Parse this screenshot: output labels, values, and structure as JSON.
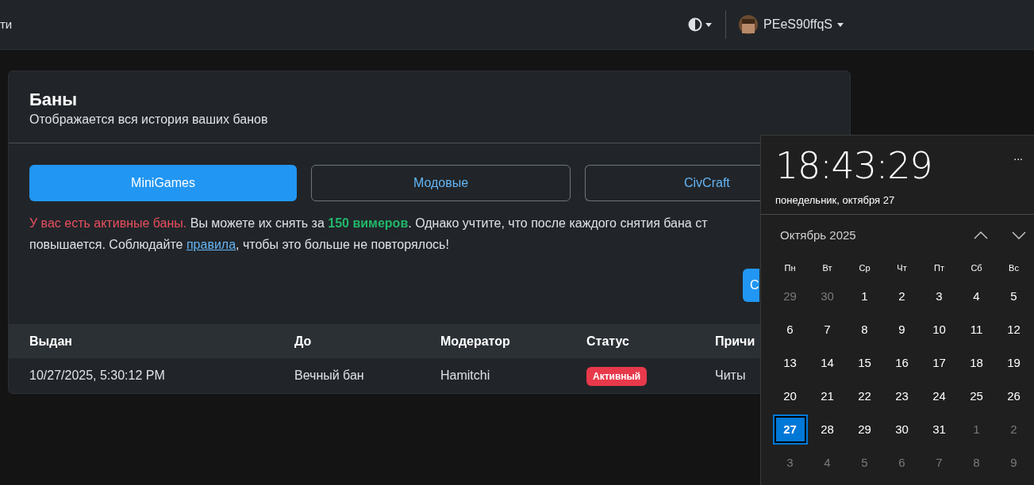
{
  "navbar": {
    "left_text": "ти",
    "username": "PEeS90ffqS"
  },
  "card": {
    "title": "Баны",
    "subtitle": "Отображается вся история ваших банов",
    "tabs": [
      {
        "label": "MiniGames",
        "selected": true
      },
      {
        "label": "Модовые",
        "selected": false
      },
      {
        "label": "CivCraft",
        "selected": false
      }
    ],
    "alert": {
      "warning": "У вас есть активные баны.",
      "line_1": " Вы можете их снять за **150 вимеров**. Однако учтите, что после каждого снятия бана ст",
      "line_2": "повышается. Соблюдайте ",
      "link": "правила",
      "line_2_end": ", чтобы это больше не повторялось!"
    },
    "action_button": "С",
    "table": {
      "columns": [
        "Выдан",
        "До",
        "Модератор",
        "Статус",
        "Причи"
      ],
      "rows": [
        {
          "issued": "10/27/2025, 5:30:12 PM",
          "until": "Вечный бан",
          "moderator": "Hamitchi",
          "status": "Активный",
          "reason": "Читы"
        }
      ]
    }
  },
  "clock_flyout": {
    "time": "18:43:29",
    "date": "понедельник, октября 27",
    "more": "...",
    "month": "Октябрь 2025",
    "weekdays": [
      "Пн",
      "Вт",
      "Ср",
      "Чт",
      "Пт",
      "Сб",
      "Вс"
    ],
    "days": [
      {
        "label": "29",
        "muted": true,
        "selected": false
      },
      {
        "label": "30",
        "muted": true,
        "selected": false
      },
      {
        "label": "1",
        "muted": false,
        "selected": false
      },
      {
        "label": "2",
        "muted": false,
        "selected": false
      },
      {
        "label": "3",
        "muted": false,
        "selected": false
      },
      {
        "label": "4",
        "muted": false,
        "selected": false
      },
      {
        "label": "5",
        "muted": false,
        "selected": false
      },
      {
        "label": "6",
        "muted": false,
        "selected": false
      },
      {
        "label": "7",
        "muted": false,
        "selected": false
      },
      {
        "label": "8",
        "muted": false,
        "selected": false
      },
      {
        "label": "9",
        "muted": false,
        "selected": false
      },
      {
        "label": "10",
        "muted": false,
        "selected": false
      },
      {
        "label": "11",
        "muted": false,
        "selected": false
      },
      {
        "label": "12",
        "muted": false,
        "selected": false
      },
      {
        "label": "13",
        "muted": false,
        "selected": false
      },
      {
        "label": "14",
        "muted": false,
        "selected": false
      },
      {
        "label": "15",
        "muted": false,
        "selected": false
      },
      {
        "label": "16",
        "muted": false,
        "selected": false
      },
      {
        "label": "17",
        "muted": false,
        "selected": false
      },
      {
        "label": "18",
        "muted": false,
        "selected": false
      },
      {
        "label": "19",
        "muted": false,
        "selected": false
      },
      {
        "label": "20",
        "muted": false,
        "selected": false
      },
      {
        "label": "21",
        "muted": false,
        "selected": false
      },
      {
        "label": "22",
        "muted": false,
        "selected": false
      },
      {
        "label": "23",
        "muted": false,
        "selected": false
      },
      {
        "label": "24",
        "muted": false,
        "selected": false
      },
      {
        "label": "25",
        "muted": false,
        "selected": false
      },
      {
        "label": "26",
        "muted": false,
        "selected": false
      },
      {
        "label": "27",
        "muted": false,
        "selected": true
      },
      {
        "label": "28",
        "muted": false,
        "selected": false
      },
      {
        "label": "29",
        "muted": false,
        "selected": false
      },
      {
        "label": "30",
        "muted": false,
        "selected": false
      },
      {
        "label": "31",
        "muted": false,
        "selected": false
      },
      {
        "label": "1",
        "muted": true,
        "selected": false
      },
      {
        "label": "2",
        "muted": true,
        "selected": false
      },
      {
        "label": "3",
        "muted": true,
        "selected": false
      },
      {
        "label": "4",
        "muted": true,
        "selected": false
      },
      {
        "label": "5",
        "muted": true,
        "selected": false
      },
      {
        "label": "6",
        "muted": true,
        "selected": false
      },
      {
        "label": "7",
        "muted": true,
        "selected": false
      },
      {
        "label": "8",
        "muted": true,
        "selected": false
      },
      {
        "label": "9",
        "muted": true,
        "selected": false
      }
    ]
  }
}
